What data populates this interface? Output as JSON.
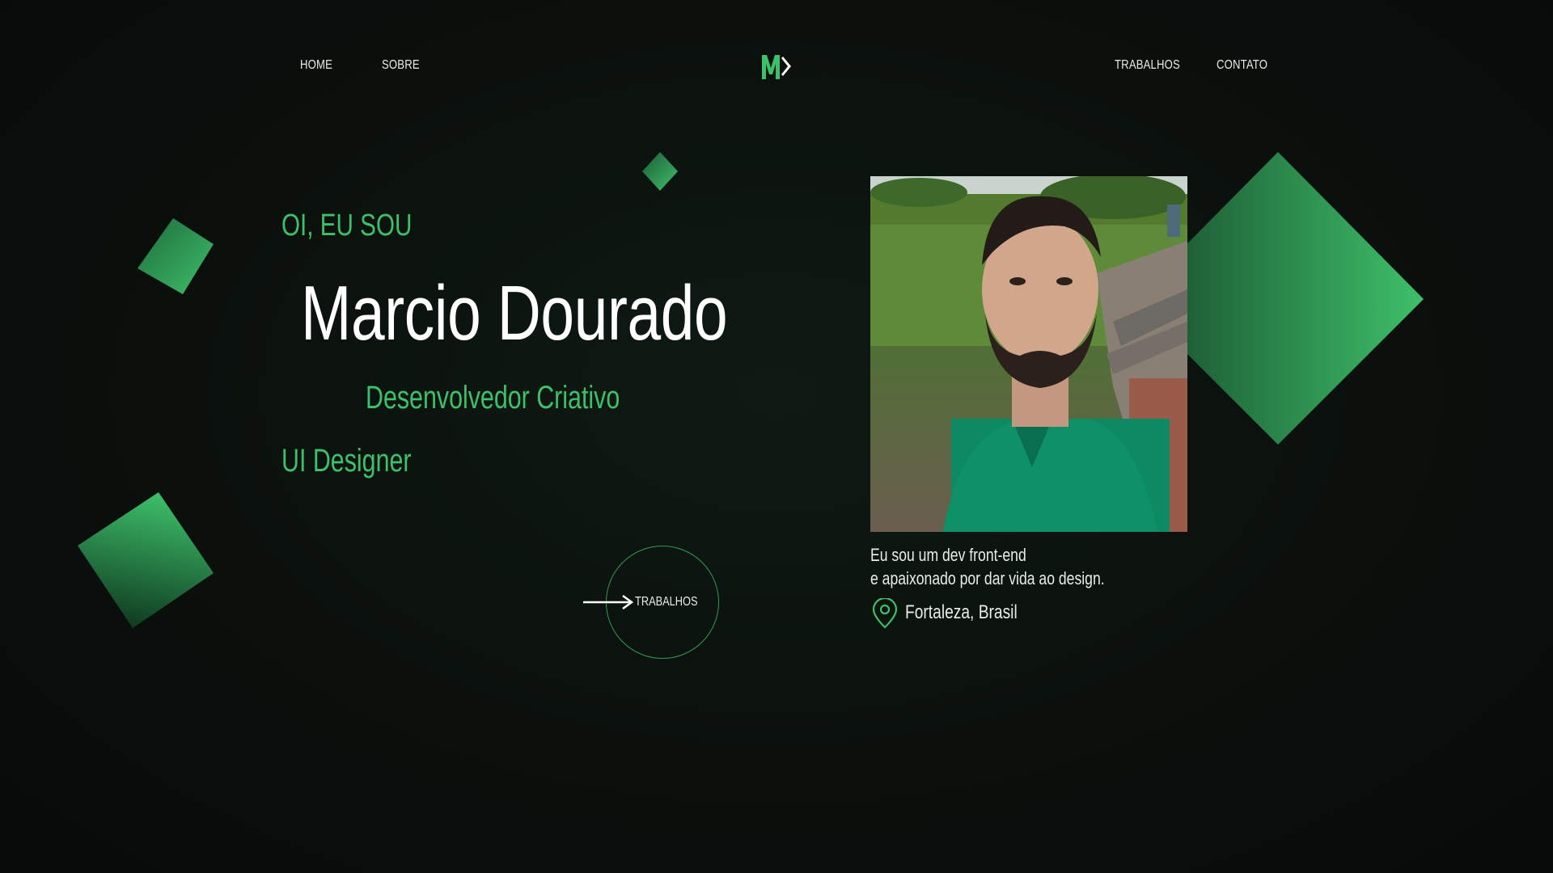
{
  "nav": {
    "home": "HOME",
    "about": "SOBRE",
    "works": "TRABALHOS",
    "contact": "CONTATO",
    "logo_text": "M"
  },
  "hero": {
    "greeting": "OI, EU SOU",
    "name": "Marcio Dourado",
    "role_primary": "Desenvolvedor Criativo",
    "role_secondary": "UI Designer",
    "cta_label": "TRABALHOS"
  },
  "profile": {
    "bio_line1": "Eu sou um dev front-end",
    "bio_line2": "e apaixonado por dar vida ao design.",
    "location": "Fortaleza, Brasil"
  },
  "colors": {
    "accent": "#3ec06a",
    "background": "#0b100d",
    "text": "#e8ece9"
  },
  "icons": {
    "logo": "brand-logo-icon",
    "location": "location-pin-icon",
    "arrow": "arrow-right-icon"
  }
}
